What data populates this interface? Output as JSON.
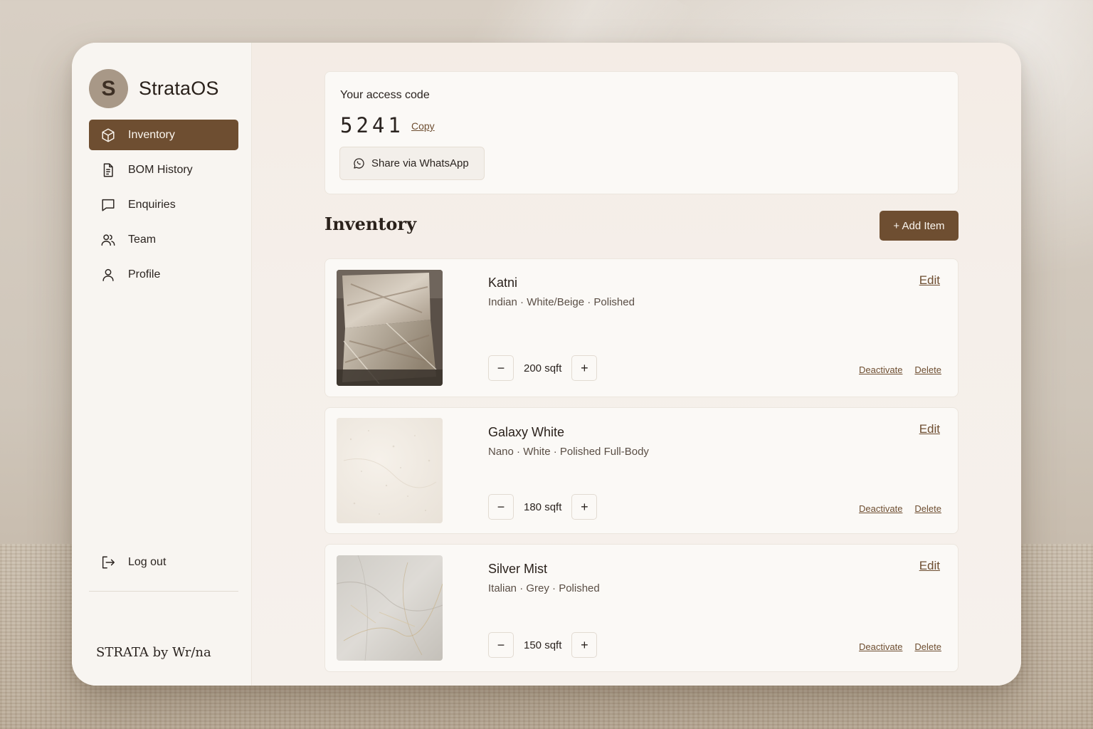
{
  "app": {
    "name": "StrataOS",
    "avatar_letter": "S",
    "footer_brand": "STRATA by Wr/na"
  },
  "sidebar": {
    "items": [
      {
        "label": "Inventory",
        "icon": "box-icon",
        "active": true
      },
      {
        "label": "BOM History",
        "icon": "document-icon",
        "active": false
      },
      {
        "label": "Enquiries",
        "icon": "chat-bubble-icon",
        "active": false
      },
      {
        "label": "Team",
        "icon": "users-icon",
        "active": false
      },
      {
        "label": "Profile",
        "icon": "user-icon",
        "active": false
      }
    ],
    "logout_label": "Log out"
  },
  "access": {
    "label": "Your access code",
    "code": "5241",
    "copy_label": "Copy",
    "share_label": "Share via WhatsApp"
  },
  "inventory": {
    "title": "Inventory",
    "add_label": "+ Add Item",
    "edit_label": "Edit",
    "deactivate_label": "Deactivate",
    "delete_label": "Delete",
    "items": [
      {
        "name": "Katni",
        "meta": "Indian · White/Beige · Polished",
        "qty": "200 sqft"
      },
      {
        "name": "Galaxy White",
        "meta": "Nano · White · Polished Full-Body",
        "qty": "180 sqft"
      },
      {
        "name": "Silver Mist",
        "meta": "Italian · Grey · Polished",
        "qty": "150 sqft"
      }
    ]
  },
  "colors": {
    "accent": "#6e4e31",
    "background": "#f6f1ec",
    "card": "#fbf9f6"
  }
}
